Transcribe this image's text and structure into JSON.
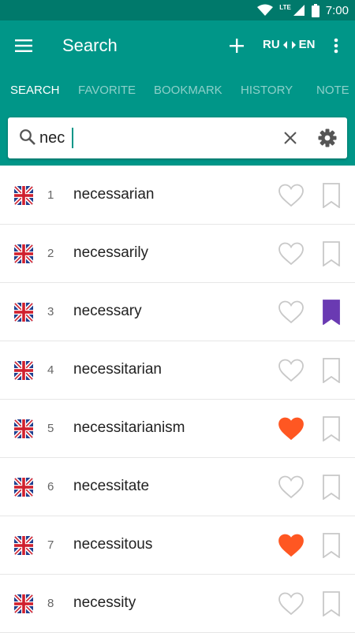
{
  "status": {
    "network": "LTE",
    "time": "7:00"
  },
  "appbar": {
    "title": "Search",
    "lang_from": "RU",
    "lang_to": "EN"
  },
  "tabs": [
    {
      "label": "SEARCH",
      "active": true
    },
    {
      "label": "FAVORITE",
      "active": false
    },
    {
      "label": "BOOKMARK",
      "active": false
    },
    {
      "label": "HISTORY",
      "active": false
    },
    {
      "label": "NOTE",
      "active": false
    }
  ],
  "search": {
    "value": "nec"
  },
  "results": [
    {
      "num": "1",
      "word": "necessarian",
      "favorite": false,
      "bookmarked": false
    },
    {
      "num": "2",
      "word": "necessarily",
      "favorite": false,
      "bookmarked": false
    },
    {
      "num": "3",
      "word": "necessary",
      "favorite": false,
      "bookmarked": true
    },
    {
      "num": "4",
      "word": "necessitarian",
      "favorite": false,
      "bookmarked": false
    },
    {
      "num": "5",
      "word": "necessitarianism",
      "favorite": true,
      "bookmarked": false
    },
    {
      "num": "6",
      "word": "necessitate",
      "favorite": false,
      "bookmarked": false
    },
    {
      "num": "7",
      "word": "necessitous",
      "favorite": true,
      "bookmarked": false
    },
    {
      "num": "8",
      "word": "necessity",
      "favorite": false,
      "bookmarked": false
    }
  ],
  "colors": {
    "primary": "#009688",
    "status_bar": "#00796b",
    "favorite": "#ff5722",
    "bookmark": "#6a3ab2",
    "inactive_icon": "#c8c8c8"
  },
  "icons": {
    "menu": "menu-icon",
    "add": "add-icon",
    "swap": "swap-icon",
    "more": "more-vert-icon",
    "search": "search-icon",
    "clear": "close-icon",
    "settings": "gear-icon",
    "flag": "uk-flag-icon",
    "favorite": "heart-icon",
    "bookmark": "bookmark-icon"
  }
}
